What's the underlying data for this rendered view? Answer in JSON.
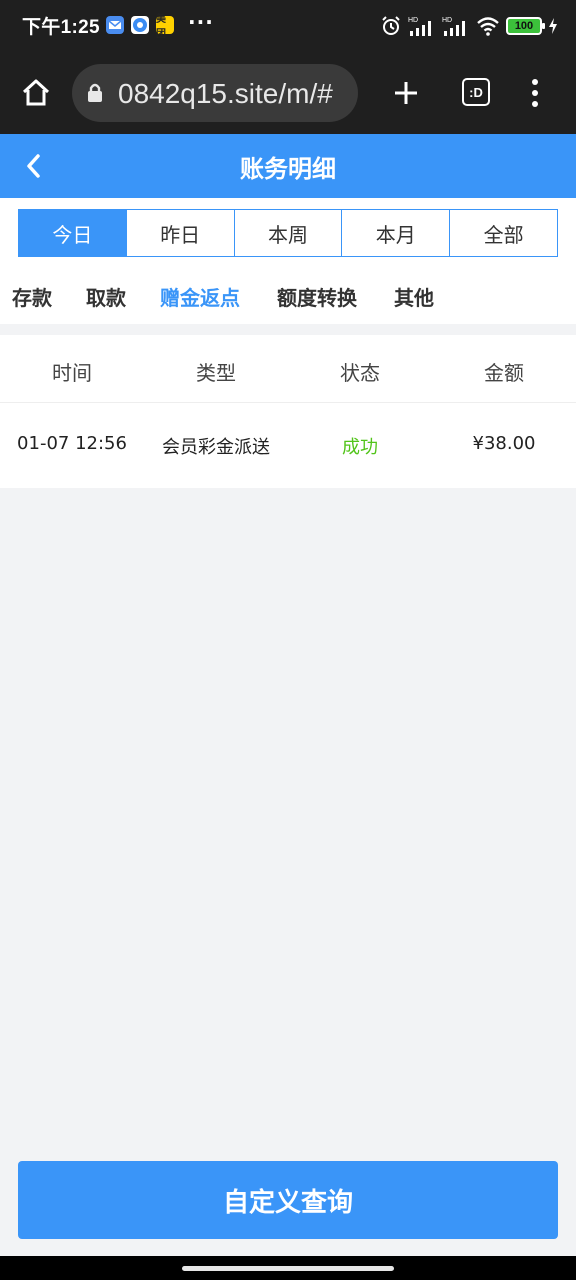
{
  "status_bar": {
    "time": "下午1:25",
    "battery": "100",
    "signal_label": "HD",
    "apps": [
      "mail-app-icon",
      "browser-app-icon",
      "meituan-app-icon"
    ],
    "meituan_label": "美团"
  },
  "browser": {
    "url": "0842q15.site/m/#",
    "tab_count_label": ":D"
  },
  "header": {
    "title": "账务明细"
  },
  "period_tabs": [
    {
      "label": "今日",
      "active": true
    },
    {
      "label": "昨日",
      "active": false
    },
    {
      "label": "本周",
      "active": false
    },
    {
      "label": "本月",
      "active": false
    },
    {
      "label": "全部",
      "active": false
    }
  ],
  "category_tabs": [
    {
      "label": "存款",
      "active": false
    },
    {
      "label": "取款",
      "active": false
    },
    {
      "label": "赠金返点",
      "active": true
    },
    {
      "label": "额度转换",
      "active": false
    },
    {
      "label": "其他",
      "active": false
    }
  ],
  "table": {
    "headers": [
      "时间",
      "类型",
      "状态",
      "金额"
    ],
    "rows": [
      {
        "time": "01-07 12:56",
        "type": "会员彩金派送",
        "status": "成功",
        "amount": "¥38.00"
      }
    ]
  },
  "footer": {
    "query_button": "自定义查询"
  },
  "colors": {
    "accent": "#3a95f8",
    "success": "#52c41a",
    "system_bar": "#1f1f1f"
  }
}
